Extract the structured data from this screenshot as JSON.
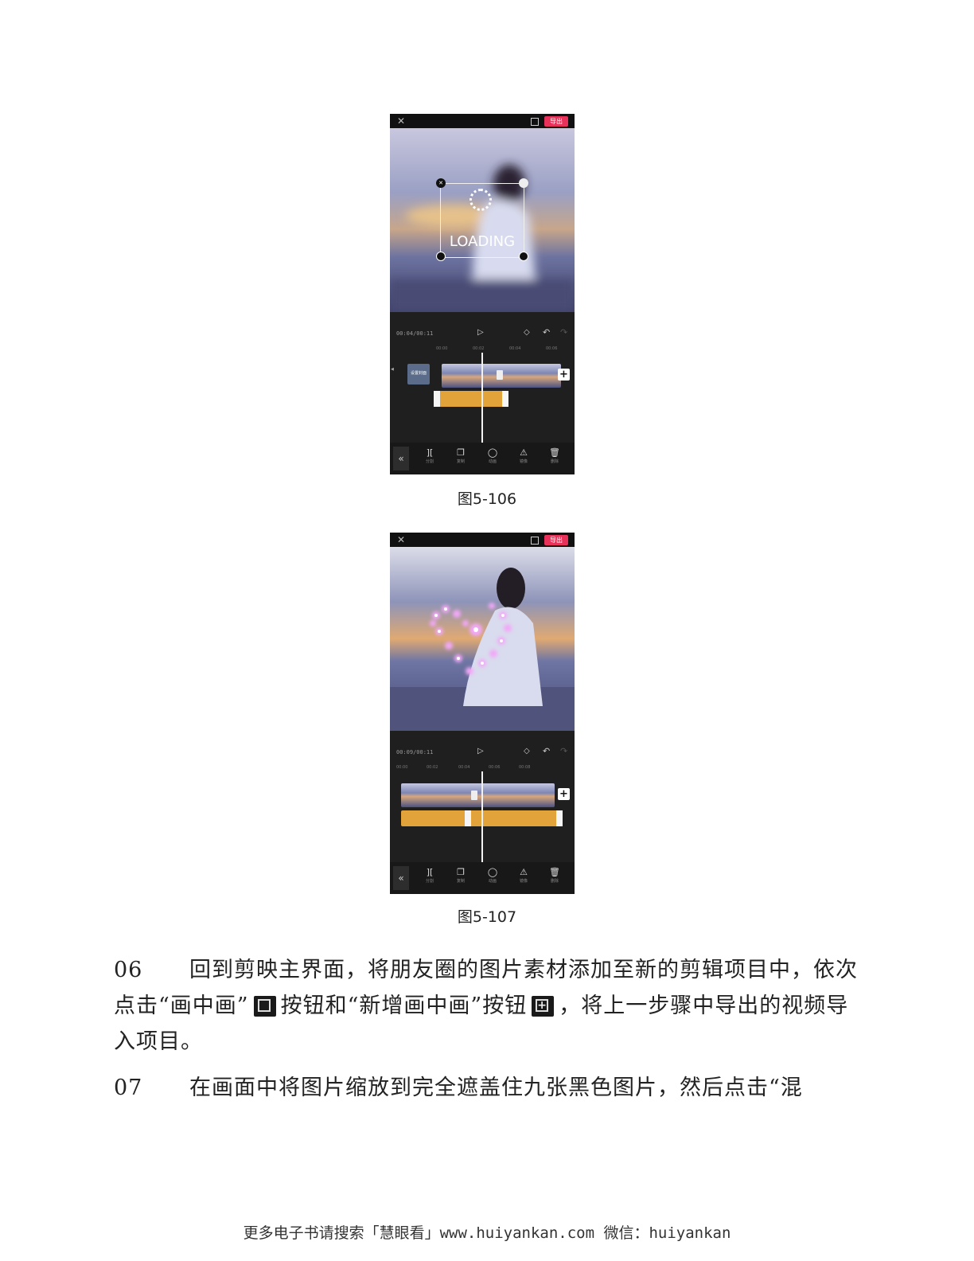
{
  "figures": [
    {
      "caption": "图5-106",
      "export_label": "导出",
      "overlay_text": "LOADING",
      "timecode": "00:04/00:11",
      "ruler_ticks": [
        "00:00",
        "00:02",
        "00:04",
        "00:06"
      ],
      "cover_label": "设置封面",
      "tools": [
        {
          "label": "分割",
          "icon": "split-icon"
        },
        {
          "label": "复制",
          "icon": "copy-icon"
        },
        {
          "label": "动画",
          "icon": "animation-icon"
        },
        {
          "label": "镜像",
          "icon": "mirror-icon"
        },
        {
          "label": "删除",
          "icon": "delete-icon"
        }
      ]
    },
    {
      "caption": "图5-107",
      "export_label": "导出",
      "timecode": "00:09/00:11",
      "ruler_ticks": [
        "00:00",
        "00:02",
        "00:04",
        "00:06",
        "00:08"
      ],
      "tools": [
        {
          "label": "分割",
          "icon": "split-icon"
        },
        {
          "label": "复制",
          "icon": "copy-icon"
        },
        {
          "label": "动画",
          "icon": "animation-icon"
        },
        {
          "label": "镜像",
          "icon": "mirror-icon"
        },
        {
          "label": "删除",
          "icon": "delete-icon"
        }
      ]
    }
  ],
  "paragraphs": {
    "p06": {
      "number": "06",
      "text_a": "回到剪映主界面，将朋友圈的图片素材添加至新的剪辑项目中，依次点击“画中画”",
      "text_b": "按钮和“新增画中画”按钮",
      "text_c": "，将上一步骤中导出的视频导入项目。",
      "icon_a": "picture-in-picture-icon",
      "icon_b": "add-pip-icon"
    },
    "p07": {
      "number": "07",
      "text": "在画面中将图片缩放到完全遮盖住九张黑色图片，然后点击“混"
    }
  },
  "footer": "更多电子书请搜索「慧眼看」www.huiyankan.com  微信：huiyankan",
  "colors": {
    "export_button": "#e8325a",
    "pip_track": "#e2a33b",
    "app_background": "#1f1f1f",
    "glow": "#e85cf0"
  }
}
